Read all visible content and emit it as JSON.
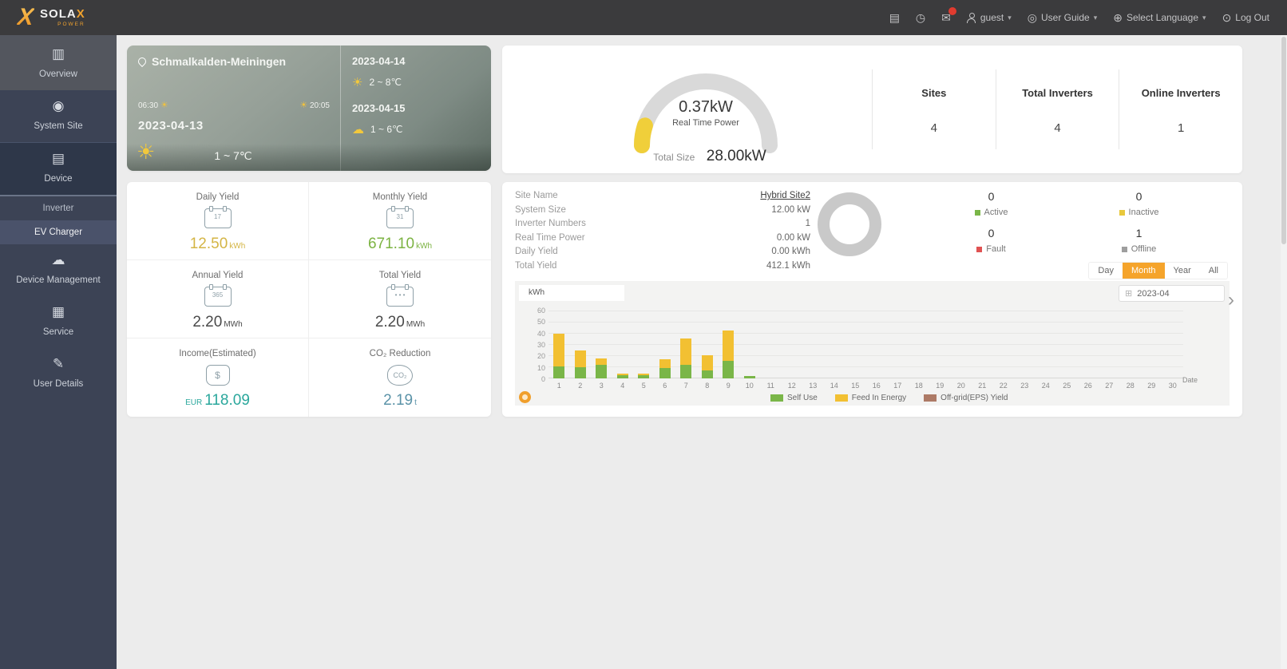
{
  "header": {
    "brand": {
      "x": "X",
      "name": "SOLA",
      "name_accent": "X",
      "sub": "POWER"
    },
    "user": "guest",
    "user_guide": "User Guide",
    "select_language": "Select Language",
    "log_out": "Log Out"
  },
  "sidebar": {
    "items": [
      {
        "label": "Overview"
      },
      {
        "label": "System Site"
      },
      {
        "label": "Device"
      },
      {
        "label": "Device Management"
      },
      {
        "label": "Service"
      },
      {
        "label": "User Details"
      }
    ],
    "device_submenu": [
      {
        "label": "Inverter"
      },
      {
        "label": "EV Charger"
      }
    ]
  },
  "weather": {
    "location": "Schmalkalden-Meiningen",
    "sunrise": "06:30",
    "sunset": "20:05",
    "today_date": "2023-04-13",
    "today_temp": "1 ~ 7℃",
    "forecast": [
      {
        "date": "2023-04-14",
        "temp": "2 ~ 8℃"
      },
      {
        "date": "2023-04-15",
        "temp": "1 ~ 6℃"
      }
    ]
  },
  "power_summary": {
    "real_time_power": "0.37kW",
    "real_time_label": "Real Time Power",
    "total_size_label": "Total Size",
    "total_size": "28.00kW",
    "gauge_color": "#f0cf3a",
    "stats": [
      {
        "label": "Sites",
        "value": "4"
      },
      {
        "label": "Total Inverters",
        "value": "4"
      },
      {
        "label": "Online Inverters",
        "value": "1"
      }
    ]
  },
  "yields": {
    "cells": [
      {
        "label": "Daily Yield",
        "value": "12.50",
        "unit": "kWh",
        "color": "#d4b545"
      },
      {
        "label": "Monthly Yield",
        "value": "671.10",
        "unit": "kWh",
        "color": "#7cb342"
      },
      {
        "label": "Annual Yield",
        "value": "2.20",
        "unit": "MWh",
        "color": "#4a4a4a"
      },
      {
        "label": "Total Yield",
        "value": "2.20",
        "unit": "MWh",
        "color": "#4a4a4a"
      },
      {
        "label": "Income(Estimated)",
        "prefix": "EUR",
        "value": "118.09",
        "unit": "",
        "color": "#2aa79c"
      },
      {
        "label": "CO₂ Reduction",
        "value": "2.19",
        "unit": "t",
        "color": "#5b93a8"
      }
    ]
  },
  "site_panel": {
    "rows": [
      {
        "label": "Site Name",
        "value": "Hybrid Site2",
        "link": true
      },
      {
        "label": "System Size",
        "value": "12.00 kW"
      },
      {
        "label": "Inverter Numbers",
        "value": "1"
      },
      {
        "label": "Real Time Power",
        "value": "0.00 kW"
      },
      {
        "label": "Daily Yield",
        "value": "0.00 kWh"
      },
      {
        "label": "Total Yield",
        "value": "412.1 kWh"
      }
    ],
    "status": [
      {
        "label": "Active",
        "count": "0",
        "color": "#7ab648"
      },
      {
        "label": "Inactive",
        "count": "0",
        "color": "#e8c83c"
      },
      {
        "label": "Fault",
        "count": "0",
        "color": "#e05252"
      },
      {
        "label": "Offline",
        "count": "1",
        "color": "#9e9e9e"
      }
    ],
    "period_buttons": [
      {
        "label": "Day",
        "active": false
      },
      {
        "label": "Month",
        "active": true
      },
      {
        "label": "Year",
        "active": false
      },
      {
        "label": "All",
        "active": false
      }
    ],
    "date_value": "2023-04",
    "accent_color": "#f5a42b"
  },
  "chart_data": {
    "type": "bar",
    "stacked": true,
    "unit_label": "kWh",
    "x": [
      "1",
      "2",
      "3",
      "4",
      "5",
      "6",
      "7",
      "8",
      "9",
      "10",
      "11",
      "12",
      "13",
      "14",
      "15",
      "16",
      "17",
      "18",
      "19",
      "20",
      "21",
      "22",
      "23",
      "24",
      "25",
      "26",
      "27",
      "28",
      "29",
      "30"
    ],
    "x_axis_caption": "Date",
    "series": [
      {
        "name": "Self Use",
        "color": "#7ab648",
        "values": [
          11,
          10,
          12,
          3,
          3,
          9,
          12,
          7,
          16,
          2,
          0,
          0,
          0,
          0,
          0,
          0,
          0,
          0,
          0,
          0,
          0,
          0,
          0,
          0,
          0,
          0,
          0,
          0,
          0,
          0
        ]
      },
      {
        "name": "Feed In Energy",
        "color": "#f2c032",
        "values": [
          29,
          15,
          6,
          1,
          1,
          8,
          24,
          14,
          27,
          0,
          0,
          0,
          0,
          0,
          0,
          0,
          0,
          0,
          0,
          0,
          0,
          0,
          0,
          0,
          0,
          0,
          0,
          0,
          0,
          0
        ]
      },
      {
        "name": "Off-grid(EPS) Yield",
        "color": "#ad7a66",
        "values": [
          0,
          0,
          0,
          0,
          0,
          0,
          0,
          0,
          0,
          0,
          0,
          0,
          0,
          0,
          0,
          0,
          0,
          0,
          0,
          0,
          0,
          0,
          0,
          0,
          0,
          0,
          0,
          0,
          0,
          0
        ]
      }
    ],
    "ylim": [
      0,
      60
    ],
    "yticks": [
      0,
      10,
      20,
      30,
      40,
      50,
      60
    ],
    "grid": true,
    "legend_position": "bottom"
  }
}
